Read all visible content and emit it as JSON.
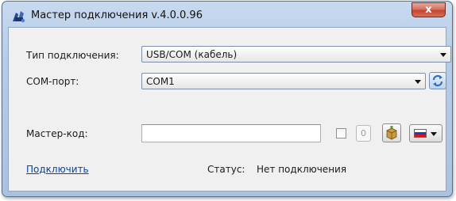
{
  "window": {
    "title": "Мастер подключения v.4.0.0.96",
    "close_label": "x"
  },
  "form": {
    "connection_type_label": "Тип подключения:",
    "connection_type_value": "USB/COM (кабель)",
    "com_port_label": "COM-порт:",
    "com_port_value": "COM1",
    "master_code_label": "Мастер-код:",
    "master_code_value": "",
    "counter_value": "0",
    "connect_link": "Подключить",
    "status_label": "Статус:",
    "status_value": "Нет подключения"
  },
  "colors": {
    "flag_white": "#ffffff",
    "flag_blue": "#1c3fb7",
    "flag_red": "#d8141c"
  }
}
